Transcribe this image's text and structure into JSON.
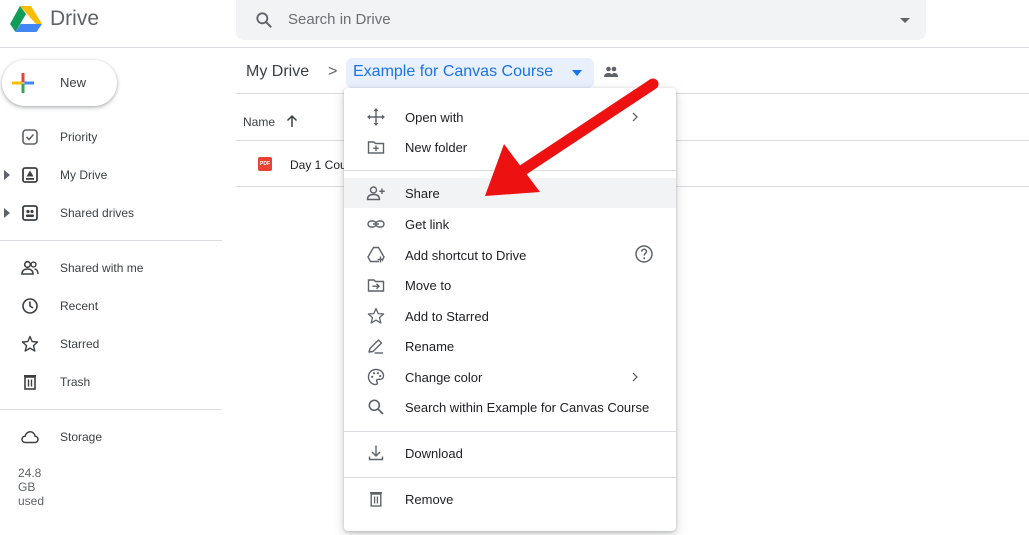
{
  "app": {
    "name": "Drive"
  },
  "search": {
    "placeholder": "Search in Drive"
  },
  "sidebar": {
    "new_label": "New",
    "items": [
      {
        "label": "Priority",
        "icon": "priority-icon"
      },
      {
        "label": "My Drive",
        "icon": "my-drive-icon"
      },
      {
        "label": "Shared drives",
        "icon": "shared-drives-icon"
      },
      {
        "label": "Shared with me",
        "icon": "shared-with-me-icon"
      },
      {
        "label": "Recent",
        "icon": "clock-icon"
      },
      {
        "label": "Starred",
        "icon": "star-icon"
      },
      {
        "label": "Trash",
        "icon": "trash-icon"
      }
    ],
    "storage": {
      "label": "Storage",
      "used": "24.8 GB used"
    }
  },
  "breadcrumb": {
    "root": "My Drive",
    "separator": ">",
    "current": "Example for Canvas Course"
  },
  "file_list": {
    "column_name": "Name",
    "files": [
      {
        "name": "Day 1 Cou",
        "type": "PDF"
      }
    ]
  },
  "context_menu": {
    "items": [
      {
        "label": "Open with",
        "icon": "move-arrows-icon",
        "submenu": true
      },
      {
        "label": "New folder",
        "icon": "new-folder-icon"
      },
      {
        "label": "Share",
        "icon": "add-person-icon",
        "highlighted": true
      },
      {
        "label": "Get link",
        "icon": "link-icon"
      },
      {
        "label": "Add shortcut to Drive",
        "icon": "add-shortcut-icon",
        "help": true
      },
      {
        "label": "Move to",
        "icon": "move-to-folder-icon"
      },
      {
        "label": "Add to Starred",
        "icon": "star-icon"
      },
      {
        "label": "Rename",
        "icon": "pencil-icon"
      },
      {
        "label": "Change color",
        "icon": "palette-icon",
        "submenu": true
      },
      {
        "label": "Search within Example for Canvas Course",
        "icon": "search-icon"
      },
      {
        "label": "Download",
        "icon": "download-icon"
      },
      {
        "label": "Remove",
        "icon": "trash-icon"
      }
    ]
  },
  "colors": {
    "accent": "#1a73e8",
    "highlight_bg": "#e8f0fe",
    "annotation_arrow": "#ee1111",
    "pdf_red": "#ea4335"
  }
}
